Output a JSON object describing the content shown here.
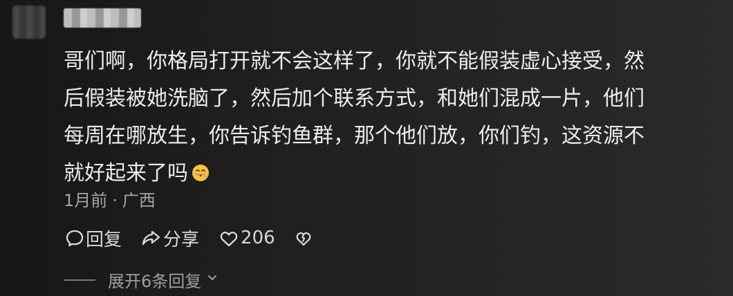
{
  "comment": {
    "lines": [
      "哥们啊，你格局打开就不会这样了，你就不能假装虚心接受，然",
      "后假装被她洗脑了，然后加个联系方式，和她们混成一片，他们",
      "每周在哪放生，你告诉钓鱼群，那个他们放，你们钓，这资源不",
      "就好起来了吗"
    ],
    "emoji_icon": "blush-emoji-icon",
    "time": "1月前",
    "location": "广西",
    "separator": "·"
  },
  "actions": {
    "reply_label": "回复",
    "share_label": "分享",
    "like_count": "206"
  },
  "expand": {
    "label": "展开6条回复"
  },
  "colors": {
    "background": "#202020",
    "text": "#e8e8e8",
    "meta": "#a7a7a7",
    "emoji": "#f4c542"
  }
}
